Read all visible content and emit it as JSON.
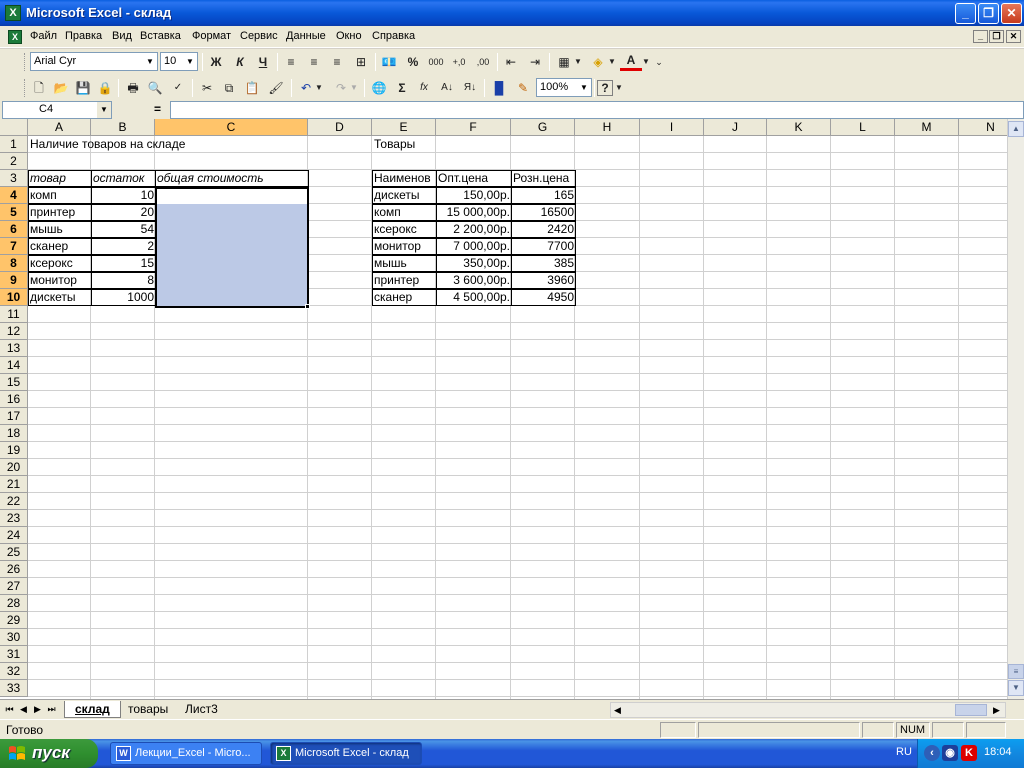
{
  "window": {
    "title": "Microsoft Excel - склад",
    "app_icon": "excel-icon",
    "controls": {
      "minimize": "_",
      "maximize": "❐",
      "close": "✕"
    }
  },
  "menu": {
    "items": [
      "Файл",
      "Правка",
      "Вид",
      "Вставка",
      "Формат",
      "Сервис",
      "Данные",
      "Окно",
      "Справка"
    ],
    "mdi_controls": {
      "minimize": "_",
      "restore": "❐",
      "close": "✕"
    }
  },
  "format_toolbar": {
    "font": "Arial Cyr",
    "size": "10",
    "bold": "Ж",
    "italic": "К",
    "underline": "Ч",
    "percent": "%",
    "thousands": "000",
    "inc_decimal": "+,0",
    "dec_decimal": ",00",
    "font_color_letter": "A"
  },
  "standard_toolbar": {
    "sum": "Σ",
    "fx": "fx",
    "zoom": "100%",
    "help": "?"
  },
  "formula_bar": {
    "namebox": "C4",
    "equals": "=",
    "value": ""
  },
  "columns": [
    "A",
    "B",
    "C",
    "D",
    "E",
    "F",
    "G",
    "H",
    "I",
    "J",
    "K",
    "L",
    "M",
    "N"
  ],
  "selected_column": "C",
  "rows": [
    "1",
    "2",
    "3",
    "4",
    "5",
    "6",
    "7",
    "8",
    "9",
    "10",
    "11",
    "12",
    "13",
    "14",
    "15",
    "16",
    "17",
    "18",
    "19",
    "20",
    "21",
    "22",
    "23",
    "24",
    "25",
    "26",
    "27",
    "28",
    "29",
    "30",
    "31",
    "32",
    "33"
  ],
  "selected_rows": [
    "4",
    "5",
    "6",
    "7",
    "8",
    "9",
    "10"
  ],
  "sheet": {
    "A1": "Наличие товаров на складе",
    "A3": "товар",
    "B3": "остаток",
    "C3": "общая стоимость",
    "inventory": [
      {
        "item": "комп",
        "qty": "10"
      },
      {
        "item": "принтер",
        "qty": "20"
      },
      {
        "item": "мышь",
        "qty": "54"
      },
      {
        "item": "сканер",
        "qty": "2"
      },
      {
        "item": "ксерокс",
        "qty": "15"
      },
      {
        "item": "монитор",
        "qty": "8"
      },
      {
        "item": "дискеты",
        "qty": "1000"
      }
    ],
    "E1": "Товары",
    "E3": "Наименов",
    "F3": "Опт.цена",
    "G3": "Розн.цена",
    "prices": [
      {
        "name": "дискеты",
        "wholesale": "150,00р.",
        "retail": "165"
      },
      {
        "name": "комп",
        "wholesale": "15 000,00р.",
        "retail": "16500"
      },
      {
        "name": "ксерокс",
        "wholesale": "2 200,00р.",
        "retail": "2420"
      },
      {
        "name": "монитор",
        "wholesale": "7 000,00р.",
        "retail": "7700"
      },
      {
        "name": "мышь",
        "wholesale": "350,00р.",
        "retail": "385"
      },
      {
        "name": "принтер",
        "wholesale": "3 600,00р.",
        "retail": "3960"
      },
      {
        "name": "сканер",
        "wholesale": "4 500,00р.",
        "retail": "4950"
      }
    ]
  },
  "tabs": {
    "sheets": [
      "склад",
      "товары",
      "Лист3"
    ],
    "active": "склад"
  },
  "status": {
    "text": "Готово",
    "num": "NUM"
  },
  "taskbar": {
    "start": "пуск",
    "windows": [
      "Лекции_Excel - Micro...",
      "Microsoft Excel - склад"
    ],
    "lang": "RU",
    "clock": "18:04"
  }
}
